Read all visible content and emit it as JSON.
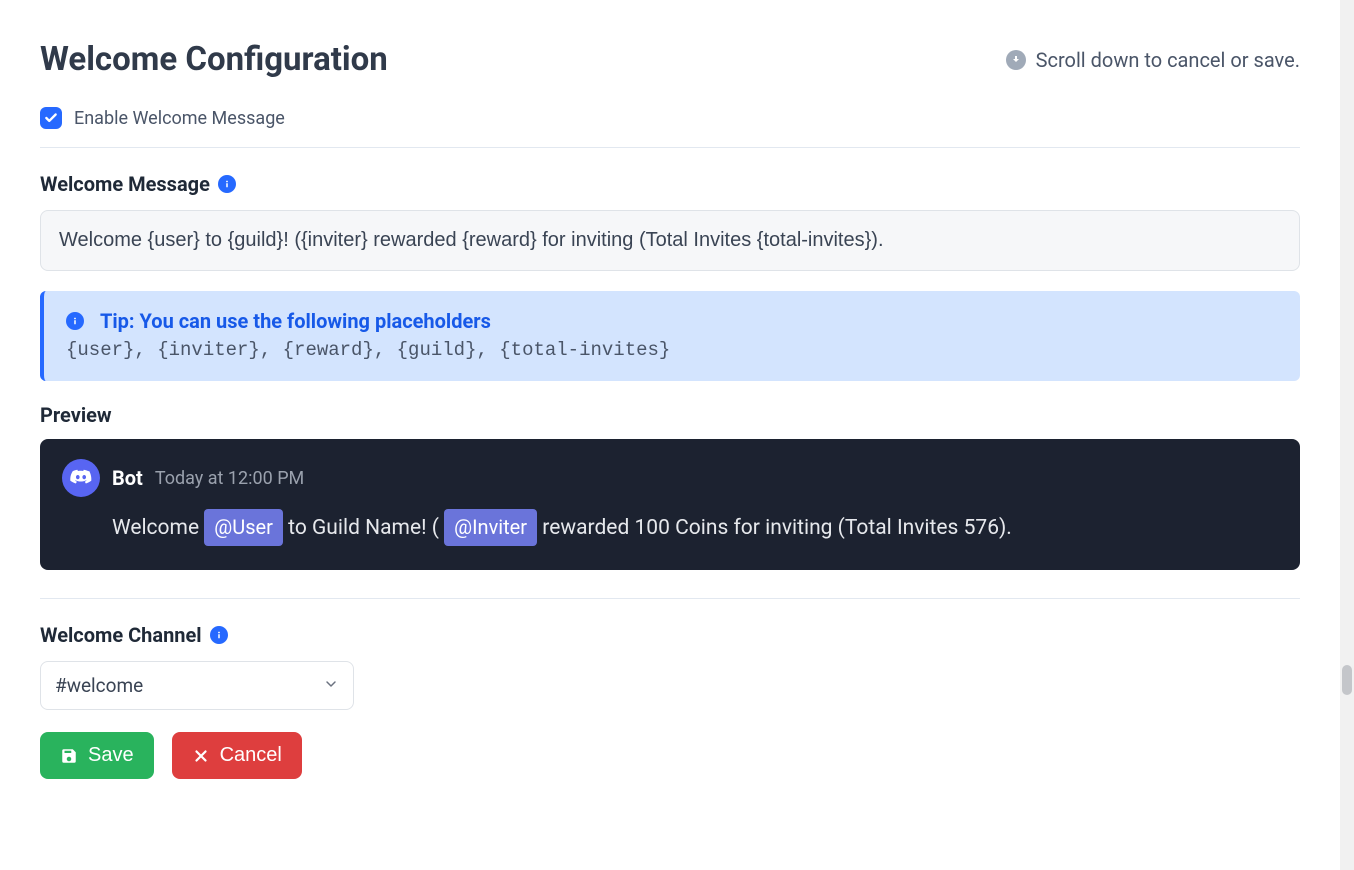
{
  "header": {
    "title": "Welcome Configuration",
    "scroll_hint": "Scroll down to cancel or save."
  },
  "enable": {
    "label": "Enable Welcome Message",
    "checked": true
  },
  "welcome_message": {
    "label": "Welcome Message",
    "value": "Welcome {user} to {guild}! ({inviter} rewarded {reward} for inviting (Total Invites {total-invites})."
  },
  "tip": {
    "title": "Tip: You can use the following placeholders",
    "body": "{user}, {inviter}, {reward}, {guild}, {total-invites}"
  },
  "preview": {
    "label": "Preview",
    "bot_name": "Bot",
    "timestamp": "Today at 12:00 PM",
    "msg_pre": "Welcome ",
    "mention_user": "@User",
    "msg_mid1": " to Guild Name! ( ",
    "mention_inviter": "@Inviter",
    "msg_post": " rewarded 100 Coins for inviting (Total Invites 576)."
  },
  "welcome_channel": {
    "label": "Welcome Channel",
    "selected": "#welcome"
  },
  "buttons": {
    "save": "Save",
    "cancel": "Cancel"
  }
}
